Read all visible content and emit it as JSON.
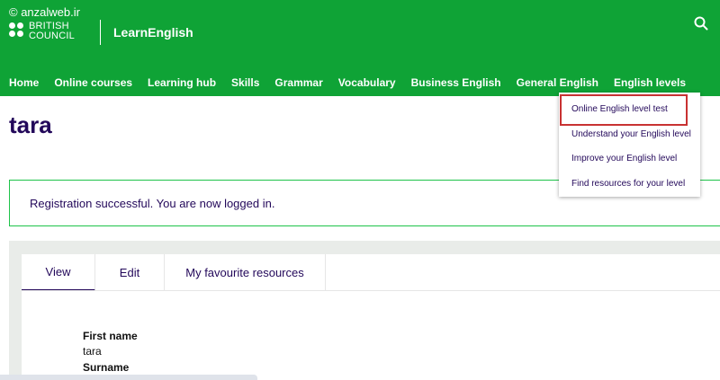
{
  "watermark": "© anzalweb.ir",
  "brand": {
    "line1": "BRITISH",
    "line2": "COUNCIL",
    "app_name": "LearnEnglish"
  },
  "icons": {
    "search": "search-icon",
    "logo": "british-council-dots-logo"
  },
  "colors": {
    "header": "#0fa336",
    "accent": "#23085a",
    "alert_border": "#1ec34a",
    "highlight": "#c83232"
  },
  "nav": {
    "items": [
      {
        "label": "Home"
      },
      {
        "label": "Online courses"
      },
      {
        "label": "Learning hub"
      },
      {
        "label": "Skills"
      },
      {
        "label": "Grammar"
      },
      {
        "label": "Vocabulary"
      },
      {
        "label": "Business English"
      },
      {
        "label": "General English"
      },
      {
        "label": "English levels"
      }
    ]
  },
  "dropdown": {
    "items": [
      {
        "label": "Online English level test"
      },
      {
        "label": "Understand your English level"
      },
      {
        "label": "Improve your English level"
      },
      {
        "label": "Find resources for your level"
      }
    ]
  },
  "page": {
    "title": "tara"
  },
  "alert": {
    "message": "Registration successful. You are now logged in."
  },
  "tabs": [
    {
      "label": "View"
    },
    {
      "label": "Edit"
    },
    {
      "label": "My favourite resources"
    }
  ],
  "profile": {
    "first_name_label": "First name",
    "first_name_value": "tara",
    "surname_label": "Surname"
  }
}
